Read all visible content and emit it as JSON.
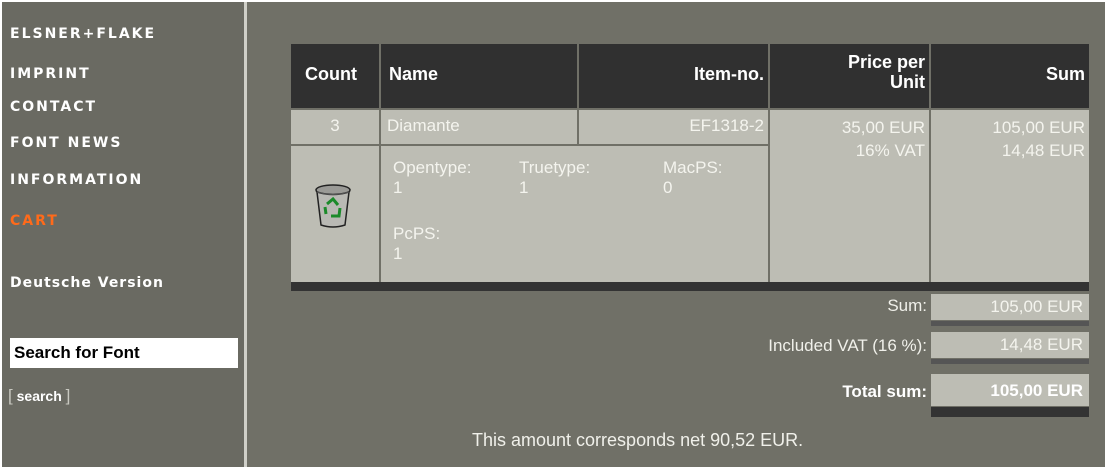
{
  "nav": {
    "brand": "ELSNER+FLAKE",
    "imprint": "IMPRINT",
    "contact": "CONTACT",
    "font_news": "FONT NEWS",
    "information": "INFORMATION",
    "cart": "CART",
    "german": "Deutsche Version"
  },
  "search": {
    "value": "Search for Font",
    "link_open": "[",
    "link_label": "search",
    "link_close": "]"
  },
  "table": {
    "headers": {
      "count": "Count",
      "name": "Name",
      "item_no": "Item-no.",
      "price_line1": "Price per",
      "price_line2": "Unit",
      "sum": "Sum"
    },
    "row": {
      "count": "3",
      "name": "Diamante",
      "item_no": "EF1318-2",
      "price": "35,00 EUR",
      "vat_rate": "16% VAT",
      "sum": "105,00 EUR",
      "vat_sum": "14,48 EUR",
      "formats": [
        {
          "label": "Opentype:",
          "value": "1"
        },
        {
          "label": "Truetype:",
          "value": "1"
        },
        {
          "label": "MacPS:",
          "value": "0"
        },
        {
          "label": "PcPS:",
          "value": "1"
        }
      ],
      "delete_icon": "trash-can-recycle-icon"
    }
  },
  "totals": {
    "sum_label": "Sum:",
    "sum_value": "105,00 EUR",
    "vat_label": "Included VAT (16 %):",
    "vat_value": "14,48 EUR",
    "total_label": "Total sum:",
    "total_value": "105,00 EUR"
  },
  "note": "This amount corresponds net 90,52 EUR.",
  "colors": {
    "active_nav": "#ff6a1a",
    "header_bg": "#303030",
    "cell_bg": "#bdbdb4"
  }
}
